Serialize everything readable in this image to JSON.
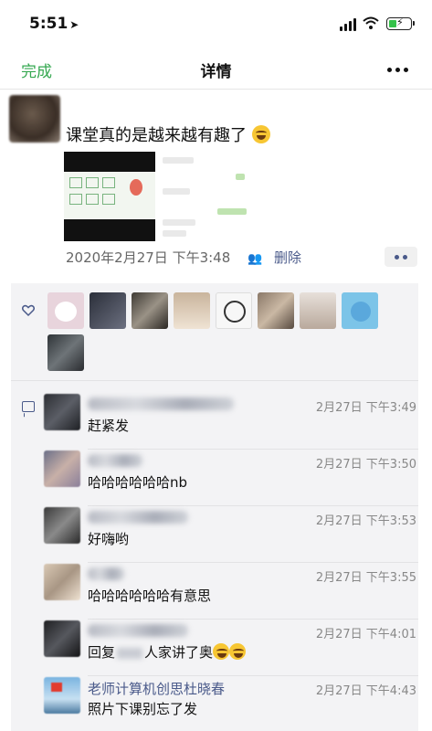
{
  "status": {
    "time": "5:51"
  },
  "nav": {
    "back_label": "完成",
    "title": "详情"
  },
  "post": {
    "text": "课堂真的是越来越有趣了",
    "date": "2020年2月27日 下午3:48",
    "delete_label": "删除"
  },
  "comments": [
    {
      "name": "",
      "time": "2月27日 下午3:49",
      "text": "赶紧发"
    },
    {
      "name": "",
      "time": "2月27日 下午3:50",
      "text": "哈哈哈哈哈哈nb"
    },
    {
      "name": "",
      "time": "2月27日 下午3:53",
      "text": "好嗨哟"
    },
    {
      "name": "",
      "time": "2月27日 下午3:55",
      "text": "哈哈哈哈哈哈有意思"
    },
    {
      "name": "",
      "time": "2月27日 下午4:01",
      "text_a": "回复",
      "text_b": "人家讲了奥"
    },
    {
      "name": "老师计算机创思杜晓春",
      "time": "2月27日 下午4:43",
      "text": "照片下课别忘了发"
    }
  ],
  "colors": {
    "accent_green": "#35a850",
    "link_blue": "#4a5a8a",
    "panel_bg": "#f3f3f5"
  }
}
